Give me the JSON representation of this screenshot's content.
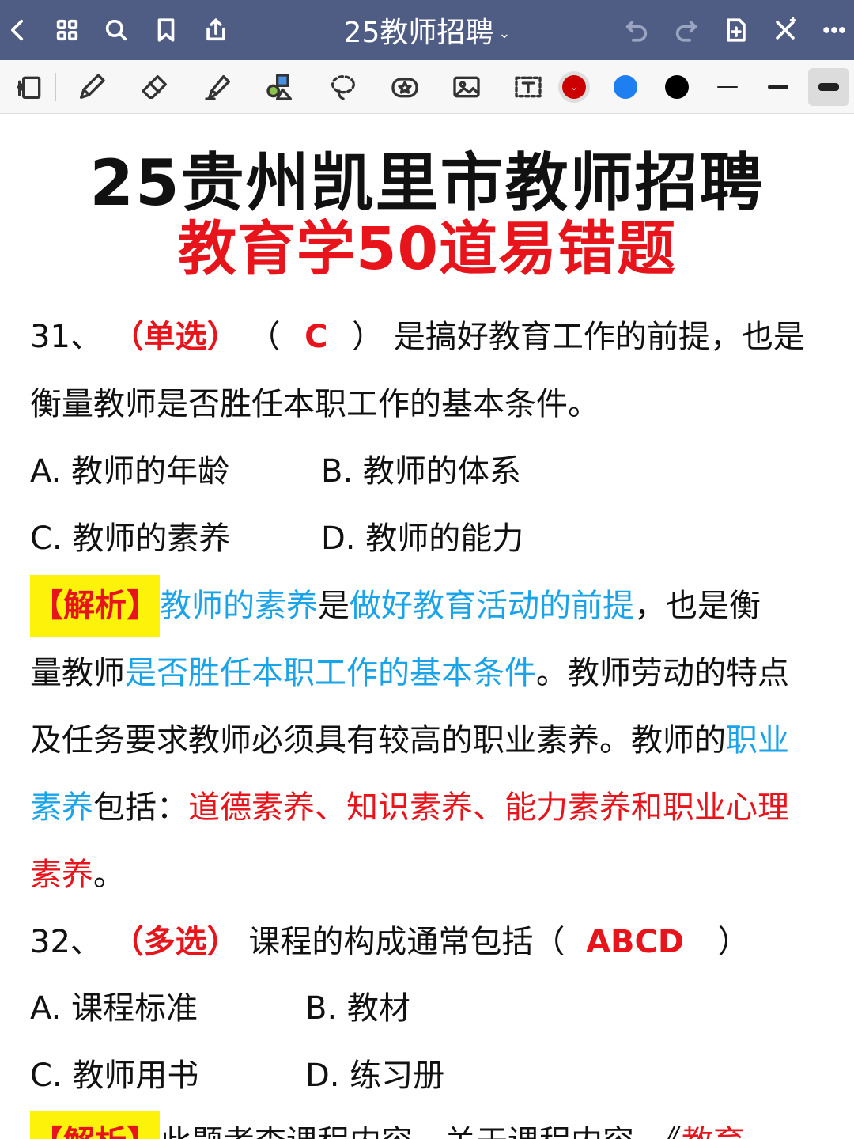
{
  "topbar": {
    "title": "25教师招聘",
    "caret": "⌄",
    "icons": [
      "back-icon",
      "grid-icon",
      "search-icon",
      "bookmark-icon",
      "share-icon",
      "undo-icon",
      "redo-icon",
      "add-page-icon",
      "close-icon",
      "more-icon"
    ]
  },
  "toolbar": {
    "tools": [
      "page-layout-icon",
      "pen-icon",
      "eraser-icon",
      "highlighter-icon",
      "shapes-icon",
      "lasso-icon",
      "sticker-icon",
      "image-icon",
      "text-box-icon"
    ],
    "colors": [
      "#cc0000",
      "#1f7ef0",
      "#000000"
    ],
    "selected_color_chevron": "⌄"
  },
  "doc": {
    "title_line1": "25贵州凯里市教师招聘",
    "title_line2": "教育学50道易错题",
    "q31": {
      "num": "31、",
      "type": "（单选）",
      "paren_open": "（",
      "answer": "C",
      "paren_close": "）",
      "stem_a": "是搞好教育工作的前提，也是",
      "stem_b": "衡量教师是否胜任本职工作的基本条件。",
      "optA": "A.  教师的年龄",
      "optB": "B.  教师的体系",
      "optC": "C.  教师的素养",
      "optD": "D.  教师的能力",
      "analysis_tag": "【解析】",
      "l1_blue1": "教师的素养",
      "l1_black1": "是",
      "l1_blue2": "做好教育活动的前提",
      "l1_black2": "，也是衡",
      "l2_black1": "量教师",
      "l2_blue1": "是否胜任本职工作的基本条件",
      "l2_black2": "。教师劳动的特点",
      "l3_black1": "及任务要求教师必须具有较高的职业素养。教师的",
      "l3_blue1": "职业",
      "l4_blue1": "素养",
      "l4_black1": "包括：",
      "l4_red1": "道德素养、知识素养、能力素养和职业心理",
      "l5_red1": "素养",
      "l5_black1": "。"
    },
    "q32": {
      "num": "32、",
      "type": "（多选）",
      "stem": "课程的构成通常包括（",
      "answer": "ABCD",
      "paren_close": "）",
      "optA": "A.  课程标准",
      "optB": "B.  教材",
      "optC": "C.  教师用书",
      "optD": "D.  练习册",
      "analysis_tag": "【解析】",
      "l1_black1": "此题考查课程内容。关于课程内容，《",
      "l1_red1": "教育"
    }
  }
}
